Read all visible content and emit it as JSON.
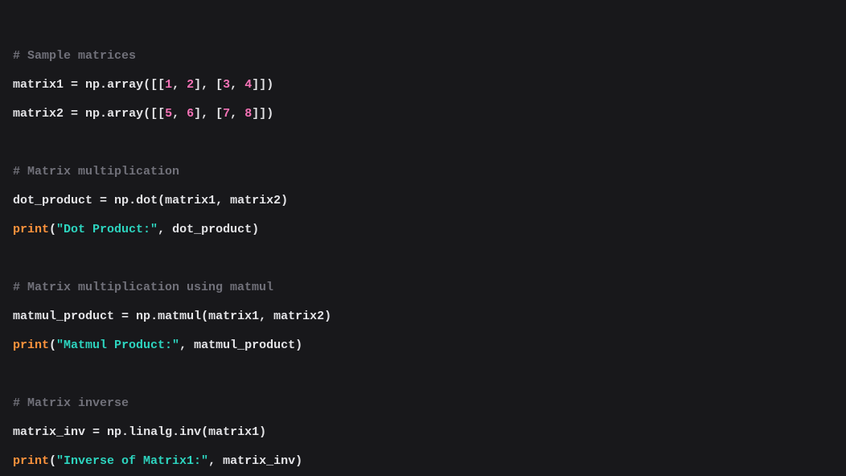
{
  "code": {
    "line1_comment": "# Sample matrices",
    "line2_var": "matrix1",
    "line2_eq": " = ",
    "line2_np": "np",
    "line2_dot": ".",
    "line2_array": "array",
    "line2_open": "([[",
    "line2_n1": "1",
    "line2_c1": ", ",
    "line2_n2": "2",
    "line2_mid": "], [",
    "line2_n3": "3",
    "line2_c2": ", ",
    "line2_n4": "4",
    "line2_close": "]])",
    "line3_var": "matrix2",
    "line3_eq": " = ",
    "line3_np": "np",
    "line3_dot": ".",
    "line3_array": "array",
    "line3_open": "([[",
    "line3_n1": "5",
    "line3_c1": ", ",
    "line3_n2": "6",
    "line3_mid": "], [",
    "line3_n3": "7",
    "line3_c2": ", ",
    "line3_n4": "8",
    "line3_close": "]])",
    "line5_comment": "# Matrix multiplication",
    "line6_var": "dot_product",
    "line6_eq": " = ",
    "line6_np": "np",
    "line6_dot": ".",
    "line6_fn": "dot",
    "line6_open": "(",
    "line6_a1": "matrix1",
    "line6_c": ", ",
    "line6_a2": "matrix2",
    "line6_close": ")",
    "line7_print": "print",
    "line7_open": "(",
    "line7_str": "\"Dot Product:\"",
    "line7_c": ", ",
    "line7_arg": "dot_product",
    "line7_close": ")",
    "line9_comment": "# Matrix multiplication using matmul",
    "line10_var": "matmul_product",
    "line10_eq": " = ",
    "line10_np": "np",
    "line10_dot": ".",
    "line10_fn": "matmul",
    "line10_open": "(",
    "line10_a1": "matrix1",
    "line10_c": ", ",
    "line10_a2": "matrix2",
    "line10_close": ")",
    "line11_print": "print",
    "line11_open": "(",
    "line11_str": "\"Matmul Product:\"",
    "line11_c": ", ",
    "line11_arg": "matmul_product",
    "line11_close": ")",
    "line13_comment": "# Matrix inverse",
    "line14_var": "matrix_inv",
    "line14_eq": " = ",
    "line14_np": "np",
    "line14_dot1": ".",
    "line14_linalg": "linalg",
    "line14_dot2": ".",
    "line14_fn": "inv",
    "line14_open": "(",
    "line14_a1": "matrix1",
    "line14_close": ")",
    "line15_print": "print",
    "line15_open": "(",
    "line15_str": "\"Inverse of Matrix1:\"",
    "line15_c": ", ",
    "line15_arg": "matrix_inv",
    "line15_close": ")"
  }
}
